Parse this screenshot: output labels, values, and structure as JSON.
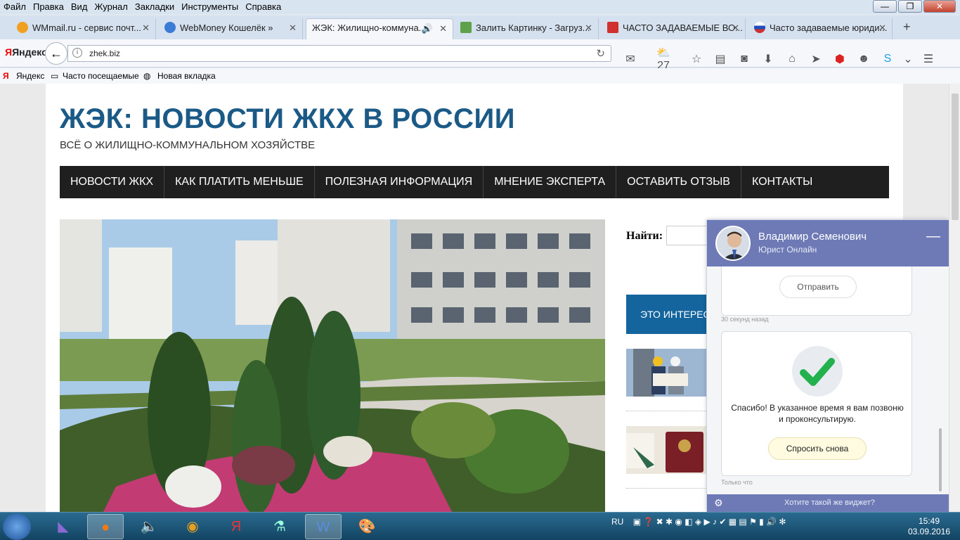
{
  "menu": [
    "Файл",
    "Правка",
    "Вид",
    "Журнал",
    "Закладки",
    "Инструменты",
    "Справка"
  ],
  "window_controls": {
    "minimize": "—",
    "maximize": "❐",
    "close": "✕"
  },
  "tabs": [
    {
      "label": "WMmail.ru - сервис почт...",
      "color": "#f0a020"
    },
    {
      "label": "WebMoney Кошелёк »",
      "color": "#3a7bd5"
    },
    {
      "label": "ЖЭК: Жилищно-коммуна...",
      "color": "#ffffff",
      "active": true
    },
    {
      "label": "Залить Картинку - Загруз...",
      "color": "#5fa04a"
    },
    {
      "label": "ЧАСТО ЗАДАВАЕМЫЕ ВО...",
      "color": "#d03030"
    },
    {
      "label": "Часто задаваемые юриди...",
      "color": "#2050c0"
    }
  ],
  "new_tab": "+",
  "browser": {
    "logo": "Яндекс",
    "url": "zhek.biz",
    "weather": "27"
  },
  "bookmarks": [
    "Яндекс",
    "Часто посещаемые",
    "Новая вкладка"
  ],
  "site": {
    "title": "ЖЭК: НОВОСТИ ЖКХ В РОССИИ",
    "subtitle": "ВСЁ О ЖИЛИЩНО-КОММУНАЛЬНОМ ХОЗЯЙСТВЕ",
    "nav": [
      "НОВОСТИ ЖКХ",
      "КАК ПЛАТИТЬ МЕНЬШЕ",
      "ПОЛЕЗНАЯ ИНФОРМАЦИЯ",
      "МНЕНИЕ ЭКСПЕРТА",
      "ОСТАВИТЬ ОТЗЫВ",
      "КОНТАКТЫ"
    ],
    "search_label": "Найти:",
    "interest": "ЭТО ИНТЕРЕСНО"
  },
  "chat": {
    "name": "Владимир Семенович",
    "role": "Юрист Онлайн",
    "send": "Отправить",
    "time1": "30 секунд назад",
    "thanks": "Спасибо! В указанное время я вам позвоню и проконсультирую.",
    "ask_again": "Спросить снова",
    "time2": "Только что",
    "footer": "Хотите такой же виджет?"
  },
  "taskbar": {
    "lang": "RU",
    "time": "15:49",
    "date": "03.09.2016"
  }
}
